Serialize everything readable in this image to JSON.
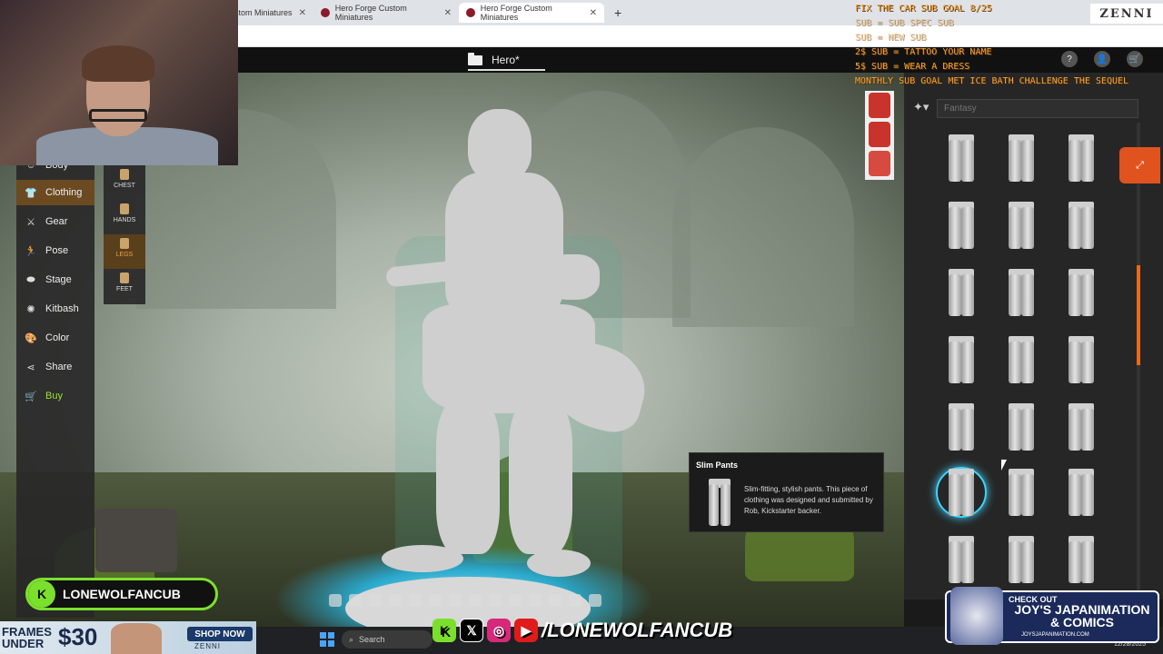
{
  "browser": {
    "tabs": [
      {
        "title": "stom Miniatures"
      },
      {
        "title": "Hero Forge Custom Miniatures"
      },
      {
        "title": "Hero Forge Custom Miniatures"
      }
    ],
    "new_tab": "+"
  },
  "header": {
    "title": "Hero*",
    "tools": [
      "?",
      "👤",
      "🛒"
    ]
  },
  "left_nav": {
    "items": [
      {
        "label": "Body",
        "icon": "body-icon"
      },
      {
        "label": "Clothing",
        "icon": "shirt-icon",
        "active": true
      },
      {
        "label": "Gear",
        "icon": "swords-icon"
      },
      {
        "label": "Pose",
        "icon": "pose-icon"
      },
      {
        "label": "Stage",
        "icon": "stage-icon"
      },
      {
        "label": "Kitbash",
        "icon": "kitbash-icon"
      },
      {
        "label": "Color",
        "icon": "palette-icon"
      },
      {
        "label": "Share",
        "icon": "share-icon"
      },
      {
        "label": "Buy",
        "icon": "cart-icon"
      }
    ]
  },
  "sub_nav": {
    "items": [
      {
        "label": "CHEST"
      },
      {
        "label": "HANDS"
      },
      {
        "label": "LEGS",
        "active": true
      },
      {
        "label": "FEET"
      }
    ]
  },
  "right_panel": {
    "filter_placeholder": "Fantasy",
    "orange_tab": "⤢"
  },
  "tooltip": {
    "title": "Slim Pants",
    "description": "Slim-fitting, stylish pants. This piece of clothing was designed and submitted by Rob, Kickstarter backer."
  },
  "overlay": {
    "sub_lines": [
      "FIX THE CAR SUB GOAL 8/25",
      "  SUB = SUB SPEC SUB",
      "  SUB = NEW SUB",
      "2$ SUB = TATTOO YOUR NAME",
      "5$ SUB = WEAR A DRESS",
      "MONTHLY SUB GOAL MET ICE BATH CHALLENGE THE SEQUEL"
    ],
    "zenni_logo": "ZENNI",
    "channel": "LONEWOLFANCUB",
    "channel_big": "/LONEWOLFANCUB",
    "ad": {
      "frames_text": "FRAMES UNDER",
      "frames_price": "$30",
      "cta": "SHOP NOW",
      "brand": "ZENNI"
    },
    "promo": {
      "check_out": "CHECK OUT",
      "title": "JOY'S JAPANIMATION & COMICS",
      "url": "JOYSJAPANIMATION.COM"
    }
  },
  "taskbar": {
    "search": "Search",
    "clock": "12/28/2025"
  },
  "colors": {
    "accent_orange": "#e0531e",
    "selected_ring": "#3fd4ff",
    "buy_green": "#9be032",
    "overlay_text": "#f2a63a"
  }
}
